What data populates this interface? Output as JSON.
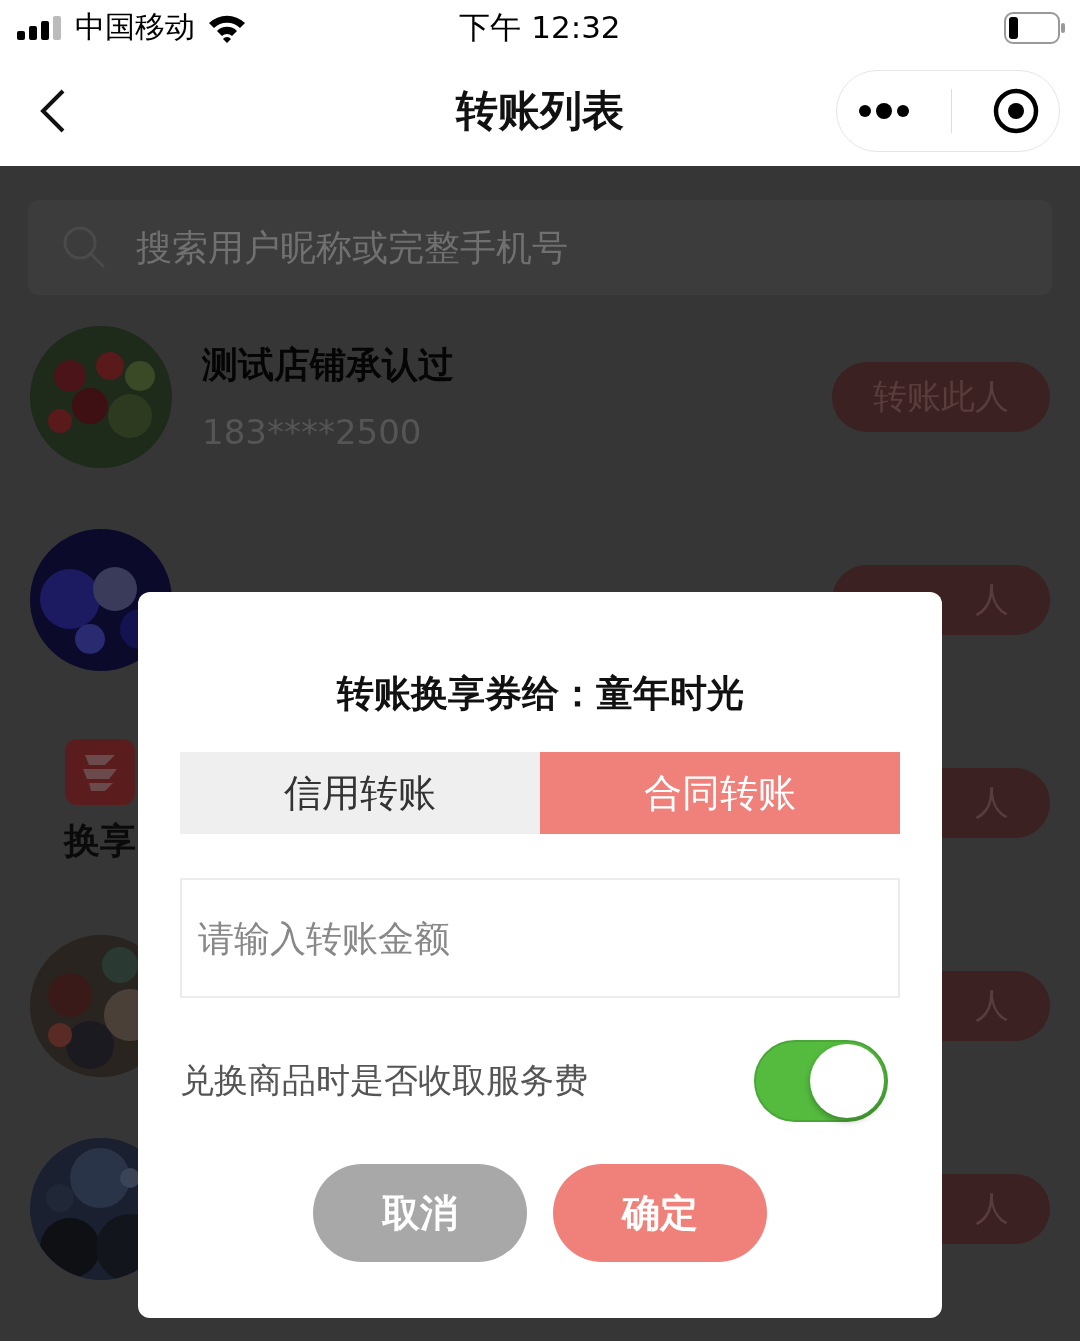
{
  "status_bar": {
    "carrier": "中国移动",
    "time": "下午 12:32"
  },
  "nav": {
    "title": "转账列表"
  },
  "search": {
    "placeholder": "搜索用户昵称或完整手机号"
  },
  "users": [
    {
      "kind": "picture",
      "name": "测试店铺承认过",
      "phone": "183****2500",
      "action": "转账此人"
    },
    {
      "kind": "picture",
      "action": "人"
    },
    {
      "kind": "logo",
      "caption": "换享",
      "action": "人"
    },
    {
      "kind": "picture",
      "action": "人"
    },
    {
      "kind": "picture",
      "action": "人"
    }
  ],
  "dialog": {
    "title": "转账换享券给：童年时光",
    "tabs": [
      {
        "label": "信用转账",
        "selected": false
      },
      {
        "label": "合同转账",
        "selected": true
      }
    ],
    "amount": {
      "placeholder": "请输入转账金额"
    },
    "fee": {
      "label": "兑换商品时是否收取服务费",
      "on": true
    },
    "buttons": [
      {
        "label": "取消",
        "kind": "cancel"
      },
      {
        "label": "确定",
        "kind": "confirm"
      }
    ]
  }
}
